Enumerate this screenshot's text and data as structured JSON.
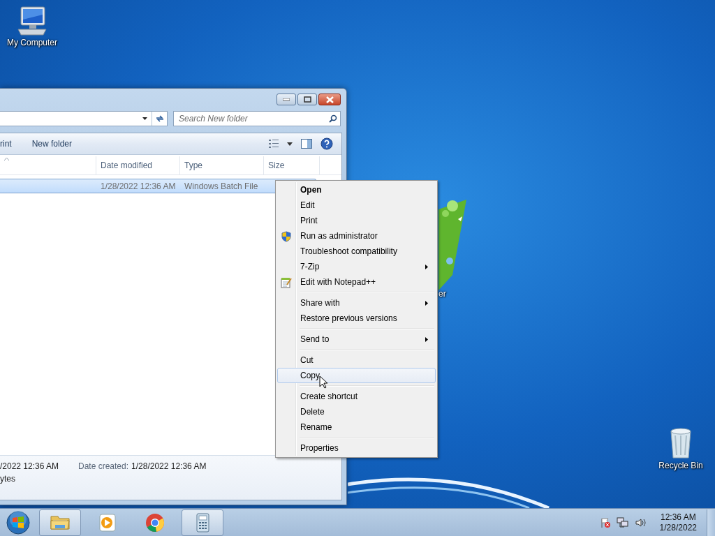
{
  "desktop_icons": [
    {
      "kind": "computer",
      "label": "My Computer"
    },
    {
      "kind": "partial",
      "label": "er"
    },
    {
      "kind": "recycle",
      "label": "Recycle Bin"
    }
  ],
  "explorer": {
    "search": {
      "placeholder": "Search New folder"
    },
    "toolbar": [
      "rint",
      "New folder"
    ],
    "columns": [
      "Date modified",
      "Type",
      "Size"
    ],
    "rows": [
      {
        "cells": [
          "1/28/2022 12:36 AM",
          "Windows Batch File"
        ],
        "selected": true
      }
    ],
    "details": {
      "modified": "/2022 12:36 AM",
      "created_label": "Date created:",
      "created": "1/28/2022 12:36 AM",
      "size": "ytes"
    }
  },
  "context_menu": [
    {
      "kind": "plain",
      "label": "Open",
      "default": true,
      "submenu": false,
      "selected": false
    },
    {
      "kind": "plain",
      "label": "Edit",
      "default": false,
      "submenu": false,
      "selected": false
    },
    {
      "kind": "plain",
      "label": "Print",
      "default": false,
      "submenu": false,
      "selected": false
    },
    {
      "kind": "shield",
      "label": "Run as administrator",
      "default": false,
      "submenu": false,
      "selected": false
    },
    {
      "kind": "plain",
      "label": "Troubleshoot compatibility",
      "default": false,
      "submenu": false,
      "selected": false
    },
    {
      "kind": "plain",
      "label": "7-Zip",
      "default": false,
      "submenu": true,
      "selected": false
    },
    {
      "kind": "notepad",
      "label": "Edit with Notepad++",
      "default": false,
      "submenu": false,
      "selected": false
    },
    {
      "kind": "separator"
    },
    {
      "kind": "plain",
      "label": "Share with",
      "default": false,
      "submenu": true,
      "selected": false
    },
    {
      "kind": "plain",
      "label": "Restore previous versions",
      "default": false,
      "submenu": false,
      "selected": false
    },
    {
      "kind": "separator"
    },
    {
      "kind": "plain",
      "label": "Send to",
      "default": false,
      "submenu": true,
      "selected": false
    },
    {
      "kind": "separator"
    },
    {
      "kind": "plain",
      "label": "Cut",
      "default": false,
      "submenu": false,
      "selected": false
    },
    {
      "kind": "plain",
      "label": "Copy",
      "default": false,
      "submenu": false,
      "selected": true
    },
    {
      "kind": "separator"
    },
    {
      "kind": "plain",
      "label": "Create shortcut",
      "default": false,
      "submenu": false,
      "selected": false
    },
    {
      "kind": "plain",
      "label": "Delete",
      "default": false,
      "submenu": false,
      "selected": false
    },
    {
      "kind": "plain",
      "label": "Rename",
      "default": false,
      "submenu": false,
      "selected": false
    },
    {
      "kind": "separator"
    },
    {
      "kind": "plain",
      "label": "Properties",
      "default": false,
      "submenu": false,
      "selected": false
    }
  ],
  "taskbar": {
    "apps": [
      {
        "kind": "explorer",
        "active": true
      },
      {
        "kind": "media",
        "active": false
      },
      {
        "kind": "chrome",
        "active": false
      },
      {
        "kind": "calculator",
        "active": true
      }
    ],
    "clock": {
      "time": "12:36 AM",
      "date": "1/28/2022"
    }
  }
}
